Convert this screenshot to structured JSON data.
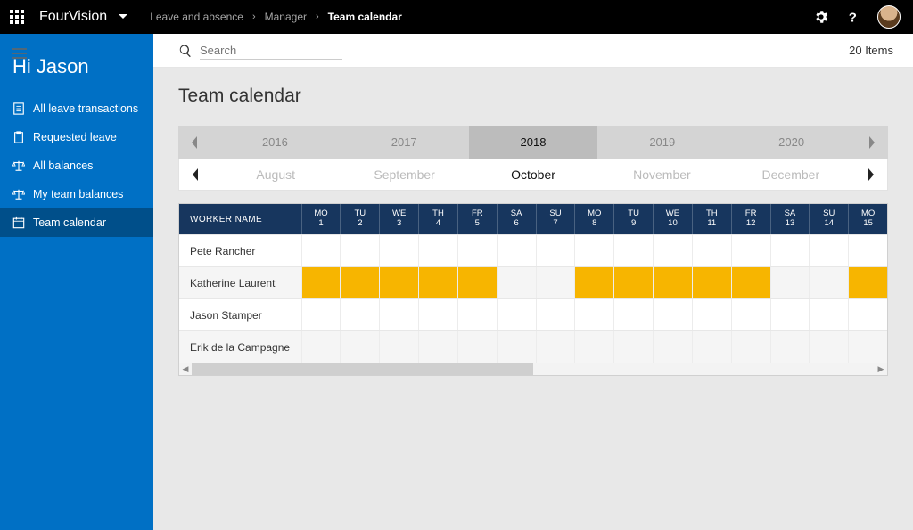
{
  "topbar": {
    "brand": "FourVision",
    "breadcrumb": [
      "Leave and absence",
      "Manager",
      "Team calendar"
    ]
  },
  "search": {
    "placeholder": "Search"
  },
  "item_count": "20 Items",
  "sidebar": {
    "greeting": "Hi Jason",
    "items": [
      {
        "label": "All leave transactions",
        "icon": "form-icon"
      },
      {
        "label": "Requested leave",
        "icon": "clipboard-icon"
      },
      {
        "label": "All balances",
        "icon": "scale-icon"
      },
      {
        "label": "My team balances",
        "icon": "scale-icon"
      },
      {
        "label": "Team calendar",
        "icon": "calendar-icon",
        "active": true
      }
    ]
  },
  "page": {
    "title": "Team calendar"
  },
  "years": [
    "2016",
    "2017",
    "2018",
    "2019",
    "2020"
  ],
  "selected_year": "2018",
  "months": [
    "August",
    "September",
    "October",
    "November",
    "December"
  ],
  "selected_month": "October",
  "calendar": {
    "worker_header": "WORKER NAME",
    "days": [
      {
        "dow": "MO",
        "num": "1"
      },
      {
        "dow": "TU",
        "num": "2"
      },
      {
        "dow": "WE",
        "num": "3"
      },
      {
        "dow": "TH",
        "num": "4"
      },
      {
        "dow": "FR",
        "num": "5"
      },
      {
        "dow": "SA",
        "num": "6"
      },
      {
        "dow": "SU",
        "num": "7"
      },
      {
        "dow": "MO",
        "num": "8"
      },
      {
        "dow": "TU",
        "num": "9"
      },
      {
        "dow": "WE",
        "num": "10"
      },
      {
        "dow": "TH",
        "num": "11"
      },
      {
        "dow": "FR",
        "num": "12"
      },
      {
        "dow": "SA",
        "num": "13"
      },
      {
        "dow": "SU",
        "num": "14"
      },
      {
        "dow": "MO",
        "num": "15"
      }
    ],
    "rows": [
      {
        "name": "Pete Rancher",
        "booked": []
      },
      {
        "name": "Katherine Laurent",
        "booked": [
          1,
          2,
          3,
          4,
          5,
          8,
          9,
          10,
          11,
          12,
          15
        ]
      },
      {
        "name": "Jason Stamper",
        "booked": []
      },
      {
        "name": "Erik de la Campagne",
        "booked": []
      }
    ]
  },
  "colors": {
    "booked": "#f7b500",
    "header_dark": "#17365e",
    "brand_blue": "#0070c5"
  }
}
